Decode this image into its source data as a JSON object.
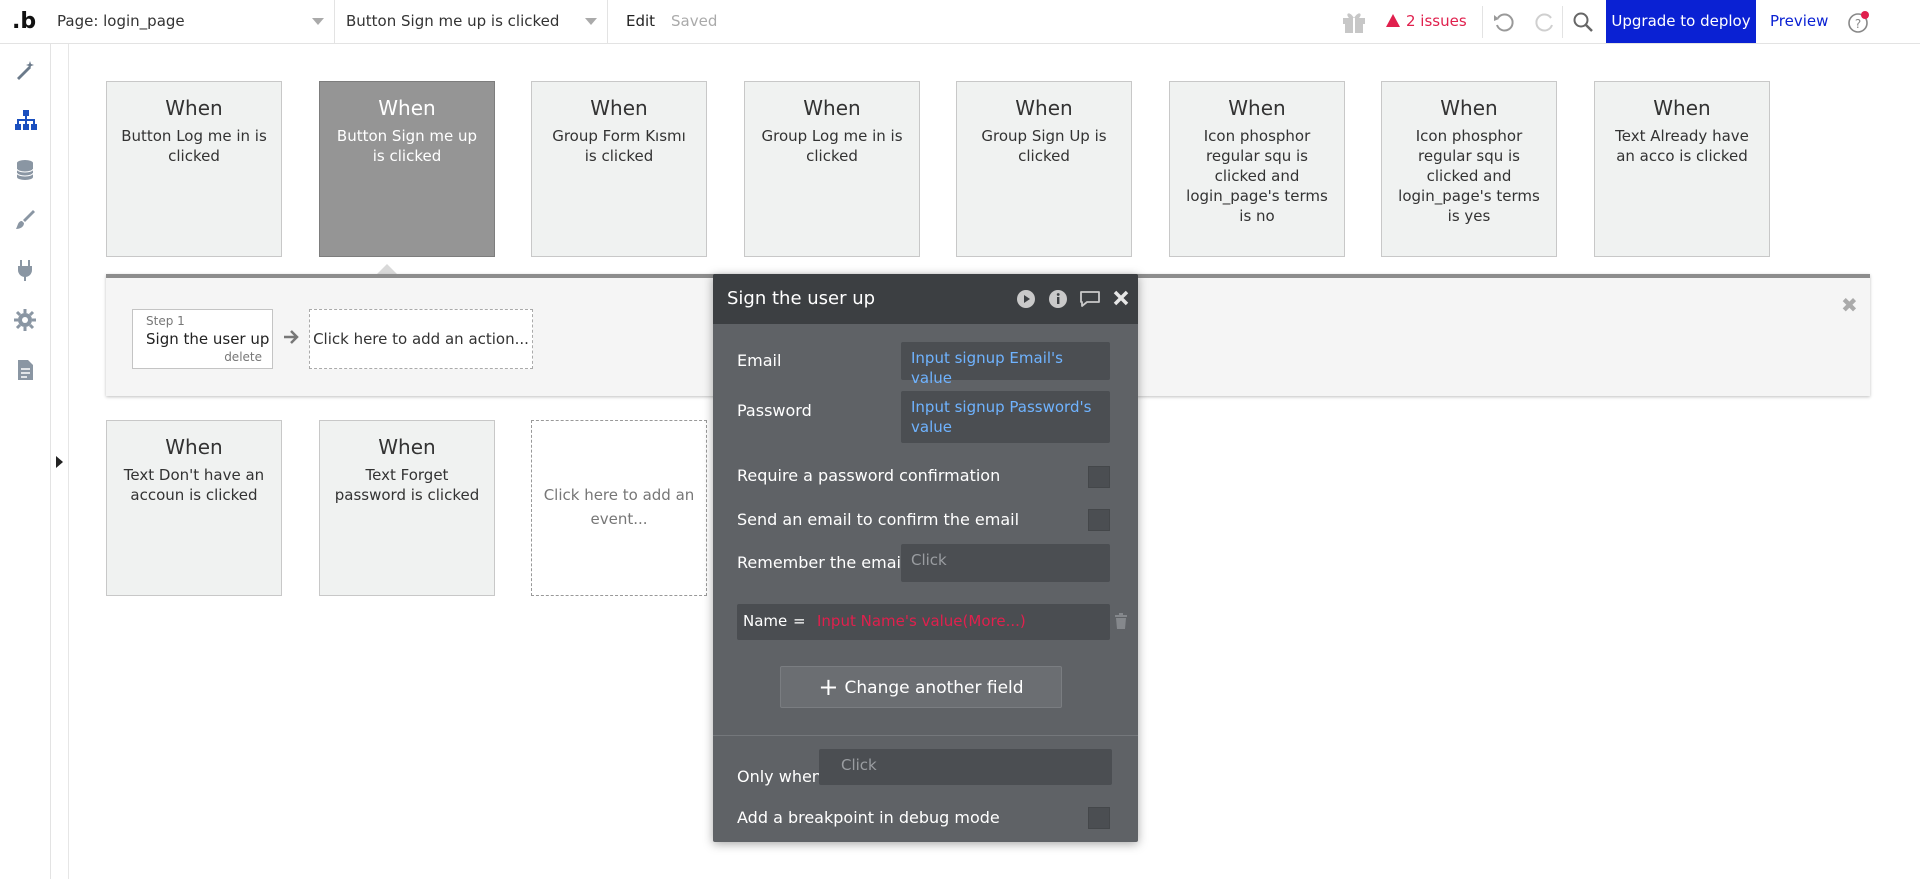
{
  "topbar": {
    "logo": ".b",
    "page_select": "Page: login_page",
    "workflow_select": "Button Sign me up is clicked",
    "edit": "Edit",
    "saved": "Saved",
    "issues": "2 issues",
    "upgrade": "Upgrade to deploy",
    "preview": "Preview"
  },
  "sidebar": {
    "items": [
      "design-icon",
      "workflow-icon",
      "data-icon",
      "styles-icon",
      "plugins-icon",
      "settings-icon",
      "logs-icon"
    ]
  },
  "events": [
    {
      "when": "When",
      "desc": "Button Log me in is clicked"
    },
    {
      "when": "When",
      "desc": "Button Sign me up is clicked"
    },
    {
      "when": "When",
      "desc": "Group Form Kısmı is clicked"
    },
    {
      "when": "When",
      "desc": "Group Log me in is clicked"
    },
    {
      "when": "When",
      "desc": "Group Sign Up is clicked"
    },
    {
      "when": "When",
      "desc": "Icon phosphor regular squ is clicked and login_page's terms is no"
    },
    {
      "when": "When",
      "desc": "Icon phosphor regular squ is clicked and login_page's terms is yes"
    },
    {
      "when": "When",
      "desc": "Text Already have an acco is clicked"
    },
    {
      "when": "When",
      "desc": "Text Don't have an accoun is clicked"
    },
    {
      "when": "When",
      "desc": "Text Forget password is clicked"
    }
  ],
  "add_event": "Click here to add an event...",
  "actions": {
    "step_label": "Step 1",
    "step_name": "Sign the user up",
    "step_delete": "delete",
    "add_action": "Click here to add an action..."
  },
  "editor": {
    "title": "Sign the user up",
    "email_label": "Email",
    "email_value": "Input signup Email's value",
    "password_label": "Password",
    "password_value": "Input signup Password's value",
    "require_confirm_label": "Require a password confirmation",
    "send_email_label": "Send an email to confirm the email",
    "remember_label": "Remember the email",
    "remember_placeholder": "Click",
    "name_label": "Name",
    "name_eq": "=",
    "name_value": "Input Name's value(More...)",
    "change_field": "Change another field",
    "only_when_label": "Only when",
    "only_when_placeholder": "Click",
    "breakpoint_label": "Add a breakpoint in debug mode"
  }
}
